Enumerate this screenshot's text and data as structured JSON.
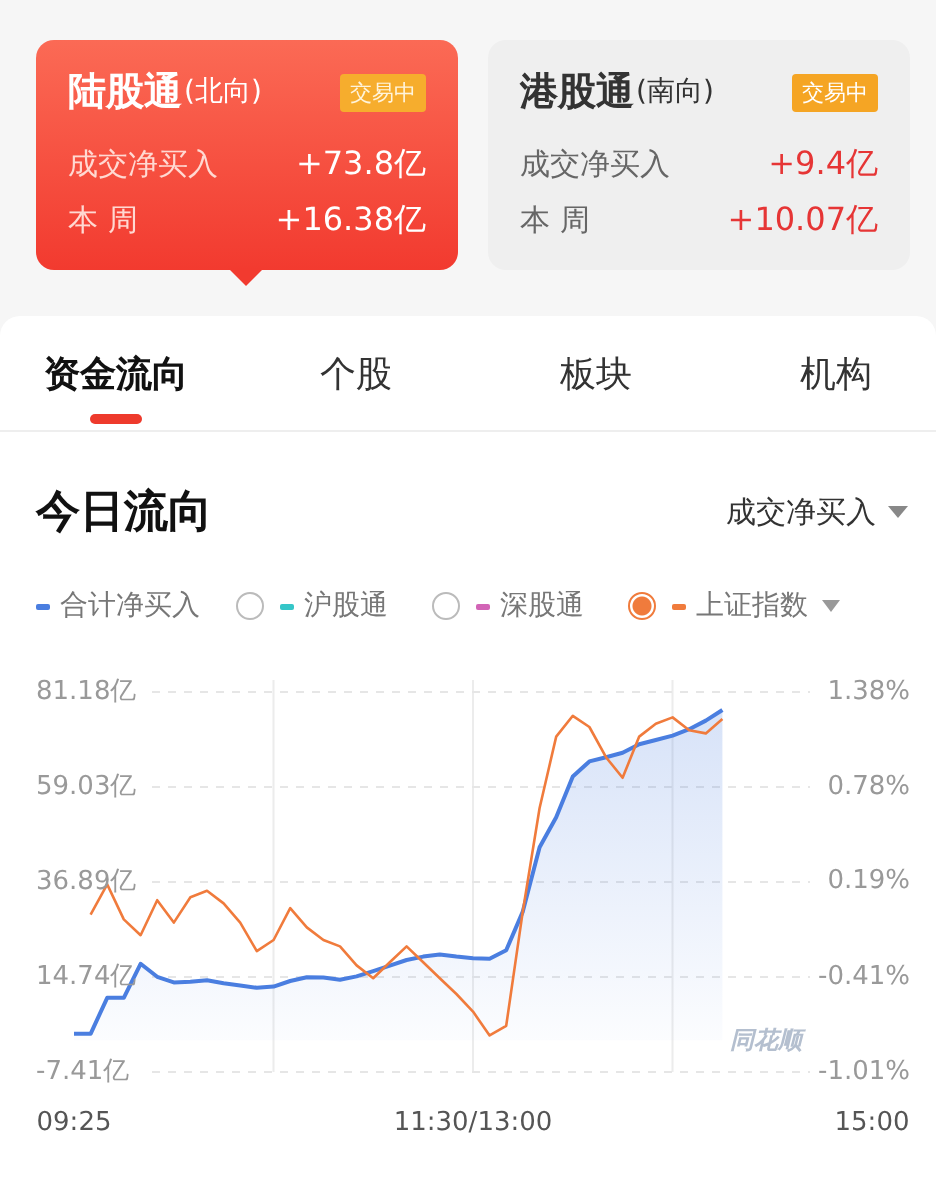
{
  "cards": [
    {
      "title": "陆股通",
      "direction": "(北向)",
      "badge": "交易中",
      "selected": true,
      "rows": [
        {
          "label": "成交净买入",
          "value": "+73.8亿"
        },
        {
          "label": "本 周",
          "value": "+16.38亿"
        }
      ]
    },
    {
      "title": "港股通",
      "direction": "(南向)",
      "badge": "交易中",
      "selected": false,
      "rows": [
        {
          "label": "成交净买入",
          "value": "+9.4亿"
        },
        {
          "label": "本 周",
          "value": "+10.07亿"
        }
      ]
    }
  ],
  "tabs": [
    {
      "label": "资金流向",
      "selected": true
    },
    {
      "label": "个股",
      "selected": false
    },
    {
      "label": "板块",
      "selected": false
    },
    {
      "label": "机构",
      "selected": false
    }
  ],
  "flow": {
    "title": "今日流向",
    "metric_selector": "成交净买入",
    "legend": [
      {
        "kind": "fixed",
        "color": "#4a7ee0"
      },
      {
        "kind": "radio",
        "label": "沪股通",
        "color": "#35c6c8",
        "selected": false
      },
      {
        "kind": "radio",
        "label": "深股通",
        "color": "#d264b6",
        "selected": false
      },
      {
        "kind": "dropdown",
        "color": "#f07b3c",
        "selected": true
      }
    ],
    "watermark": "同花顺",
    "chart_data": {
      "type": "area",
      "grid": true,
      "categories": [
        "09:25",
        null,
        null,
        null,
        null,
        null,
        null,
        null,
        null,
        null,
        null,
        null,
        null,
        null,
        null,
        null,
        null,
        null,
        null,
        null,
        null,
        null,
        null,
        null,
        "11:30/13:00",
        null,
        null,
        null,
        null,
        null,
        null,
        null,
        null,
        null,
        null,
        null,
        null,
        null,
        null,
        null,
        null,
        null,
        null,
        null,
        null,
        null,
        null,
        null,
        "15:00"
      ],
      "ylim": [
        -7.41,
        81.18
      ],
      "yticks": [
        {
          "value": 81.18,
          "label": "81.18亿"
        },
        {
          "value": 59.03,
          "label": "59.03亿"
        },
        {
          "value": 36.89,
          "label": "36.89亿"
        },
        {
          "value": 14.74,
          "label": "14.74亿"
        },
        {
          "value": -7.41,
          "label": "-7.41亿"
        }
      ],
      "y2lim": [
        -1.01,
        1.38
      ],
      "y2ticks": [
        {
          "value": 1.38,
          "label": "1.38%"
        },
        {
          "value": 0.78,
          "label": "0.78%"
        },
        {
          "value": 0.19,
          "label": "0.19%"
        },
        {
          "value": -0.41,
          "label": "-0.41%"
        },
        {
          "value": -1.01,
          "label": "-1.01%"
        }
      ],
      "series": [
        {
          "name": "合计净买入",
          "color": "#4a7ee0",
          "values": [
            1.5,
            1.5,
            9.9,
            9.9,
            17.8,
            14.8,
            13.5,
            13.6,
            14,
            13.3,
            12.8,
            12.2,
            12.5,
            13.8,
            14.7,
            14.6,
            14.1,
            14.9,
            16.1,
            17.4,
            18.7,
            19.5,
            20,
            19.5,
            19.1,
            19,
            21,
            30,
            45,
            52,
            61.5,
            65,
            66,
            67,
            69,
            70,
            71,
            72.5,
            74.5,
            77,
            null,
            null,
            null,
            null,
            null,
            null,
            null,
            null,
            null
          ]
        },
        {
          "name": "上证指数",
          "color": "#f07b3c",
          "axis": "y2",
          "type": "line",
          "values": [
            null,
            -0.02,
            0.17,
            -0.05,
            -0.15,
            0.07,
            -0.07,
            0.09,
            0.13,
            0.05,
            -0.07,
            -0.25,
            -0.18,
            0.02,
            -0.1,
            -0.18,
            -0.22,
            -0.34,
            -0.42,
            -0.32,
            -0.22,
            -0.32,
            -0.42,
            -0.52,
            -0.63,
            -0.78,
            -0.72,
            0.0,
            0.65,
            1.1,
            1.23,
            1.16,
            0.97,
            0.84,
            1.1,
            1.18,
            1.22,
            1.14,
            1.12,
            1.21,
            null,
            null,
            null,
            null,
            null,
            null,
            null,
            null,
            null
          ]
        }
      ]
    }
  }
}
